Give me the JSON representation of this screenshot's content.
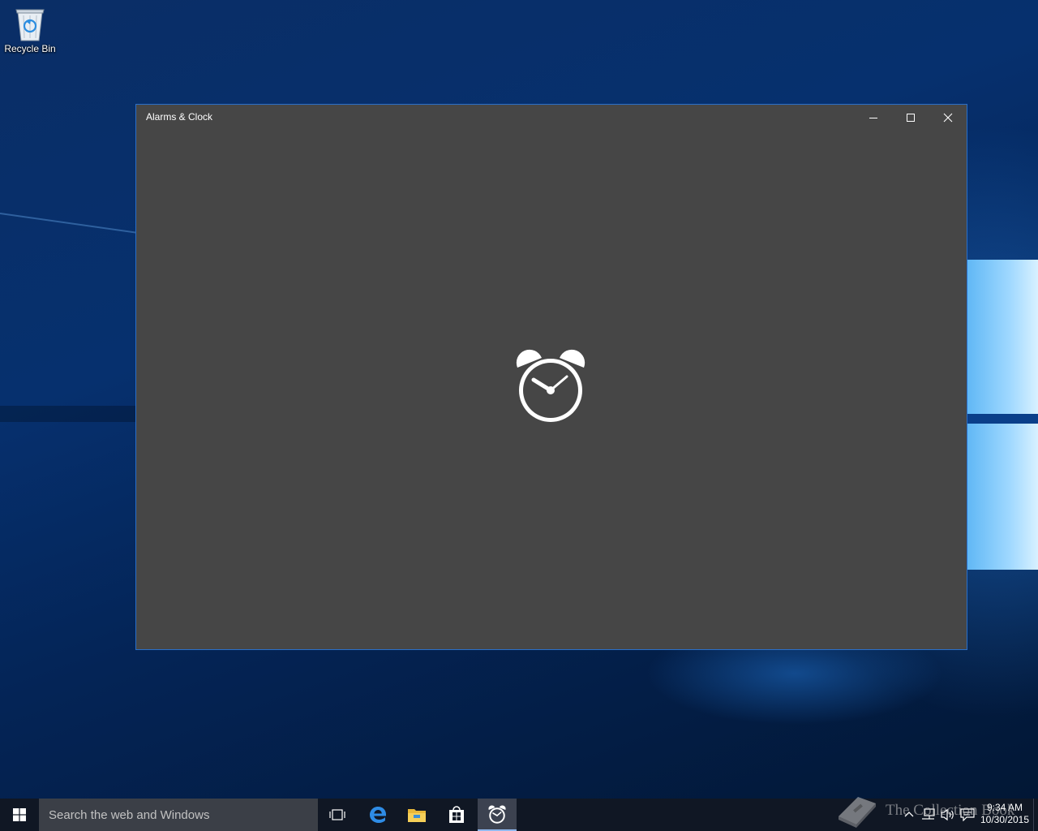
{
  "desktop": {
    "icons": [
      {
        "label": "Recycle Bin",
        "icon": "recycle-bin-icon"
      }
    ]
  },
  "window": {
    "title": "Alarms & Clock",
    "controls": {
      "minimize": "minimize-icon",
      "maximize": "maximize-icon",
      "close": "close-icon"
    },
    "splash_icon": "alarm-clock-icon",
    "background_color": "#464646",
    "border_color": "#2a6fc9"
  },
  "taskbar": {
    "search_placeholder": "Search the web and Windows",
    "pinned": [
      "task-view-icon",
      "edge-icon",
      "file-explorer-icon",
      "store-icon",
      "alarms-clock-icon"
    ],
    "active_app": "alarms-clock-icon",
    "clock": {
      "time": "9:34 AM",
      "date": "10/30/2015"
    },
    "background_color": "#101724"
  },
  "watermark": {
    "text": "The Collection Book"
  }
}
